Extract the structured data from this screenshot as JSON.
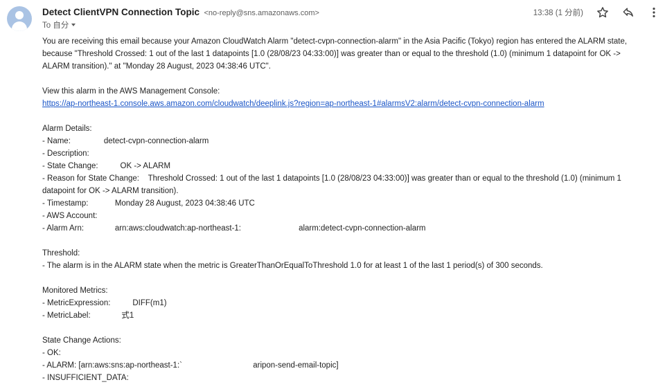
{
  "header": {
    "sender_name": "Detect ClientVPN Connection Topic",
    "sender_email": "<no-reply@sns.amazonaws.com>",
    "to_line": "To 自分",
    "time": "13:38 (1 分前)"
  },
  "icons": {
    "avatar": "person-avatar",
    "star": "star-icon",
    "reply": "reply-icon",
    "more": "more-vert-icon",
    "to_caret": "caret-down-icon"
  },
  "colors": {
    "link": "#1a55c7",
    "avatar_bg": "#aac3e4"
  },
  "body": {
    "intro_1": "You are receiving this email because your Amazon CloudWatch Alarm \"detect-cvpn-connection-alarm\" in the Asia Pacific (Tokyo) region has entered the ALARM state,",
    "intro_2": "because \"Threshold Crossed: 1 out of the last 1 datapoints [1.0 (28/08/23 04:33:00)] was greater than or equal to the threshold (1.0) (minimum 1 datapoint for OK ->",
    "intro_3": "ALARM transition).\" at \"Monday 28 August, 2023 04:38:46 UTC\".",
    "console_label": "View this alarm in the AWS Management Console:",
    "console_url": "https://ap-northeast-1.console.aws.amazon.com/cloudwatch/deeplink.js?region=ap-northeast-1#alarmsV2:alarm/detect-cvpn-connection-alarm",
    "alarm_details": {
      "heading": "Alarm Details:",
      "name_label": "- Name:",
      "name_value": "detect-cvpn-connection-alarm",
      "description_label": "- Description:",
      "state_change_label": "- State Change:",
      "state_change_value": "OK -> ALARM",
      "reason_label": "- Reason for State Change:",
      "reason_value_1": "Threshold Crossed: 1 out of the last 1 datapoints [1.0 (28/08/23 04:33:00)] was greater than or equal to the threshold (1.0) (minimum 1",
      "reason_value_2": "datapoint for OK -> ALARM transition).",
      "timestamp_label": "- Timestamp:",
      "timestamp_value": "Monday 28 August, 2023 04:38:46 UTC",
      "account_label": "- AWS Account:",
      "arn_label": "- Alarm Arn:",
      "arn_value_1": "arn:aws:cloudwatch:ap-northeast-1:",
      "arn_value_2": "alarm:detect-cvpn-connection-alarm"
    },
    "threshold": {
      "heading": "Threshold:",
      "text": "- The alarm is in the ALARM state when the metric is GreaterThanOrEqualToThreshold 1.0 for at least 1 of the last 1 period(s) of 300 seconds."
    },
    "monitored_metrics": {
      "heading": "Monitored Metrics:",
      "expression_label": "- MetricExpression:",
      "expression_value": "DIFF(m1)",
      "label_label": "- MetricLabel:",
      "label_value": "式1"
    },
    "actions": {
      "heading": "State Change Actions:",
      "ok": "- OK:",
      "alarm_label": "- ALARM: [arn:aws:sns:ap-northeast-1:`",
      "alarm_value": "aripon-send-email-topic]",
      "insufficient": "- INSUFFICIENT_DATA:"
    }
  }
}
